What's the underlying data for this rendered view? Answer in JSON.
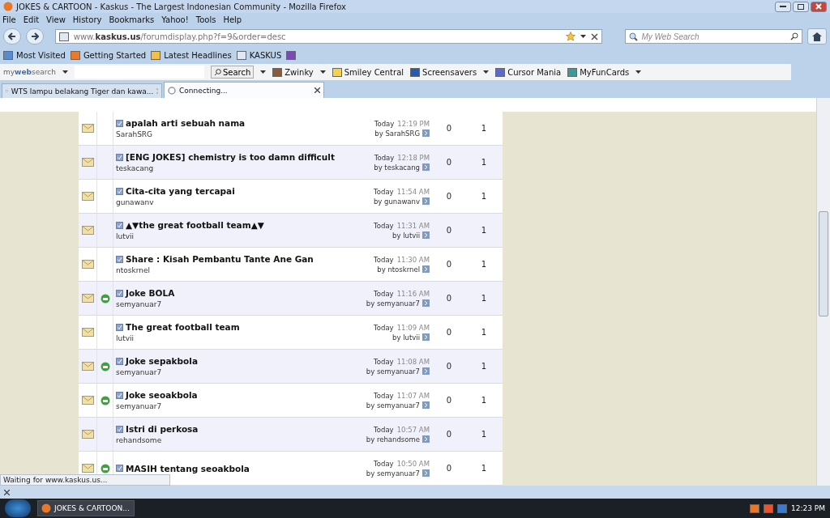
{
  "window": {
    "title": "JOKES & CARTOON - Kaskus - The Largest Indonesian Community - Mozilla Firefox"
  },
  "menu": [
    "File",
    "Edit",
    "View",
    "History",
    "Bookmarks",
    "Yahoo!",
    "Tools",
    "Help"
  ],
  "address": {
    "host": "www.",
    "domain": "kaskus.us",
    "path": "/forumdisplay.php?f=9&order=desc"
  },
  "search": {
    "placeholder": "My Web Search"
  },
  "bookmarks": [
    "Most Visited",
    "Getting Started",
    "Latest Headlines",
    "KASKUS"
  ],
  "toolbar": {
    "brand_prefix": "my",
    "brand_bold": "web",
    "brand_suffix": "search",
    "search_button": "Search",
    "items": [
      "Zwinky",
      "Smiley Central",
      "Screensavers",
      "Cursor Mania",
      "MyFunCards"
    ]
  },
  "tabs": [
    {
      "label": "WTS lampu belakang Tiger dan kawa...",
      "selected": false
    },
    {
      "label": "Connecting...",
      "selected": true
    }
  ],
  "threads": [
    {
      "title": "apalah arti sebuah nama",
      "author": "SarahSRG",
      "posticon": false,
      "date": "Today",
      "time": "12:19 PM",
      "by": "by SarahSRG",
      "replies": "0",
      "views": "1"
    },
    {
      "title": "[ENG JOKES] chemistry is too damn difficult",
      "author": "teskacang",
      "posticon": false,
      "date": "Today",
      "time": "12:18 PM",
      "by": "by teskacang",
      "replies": "0",
      "views": "1"
    },
    {
      "title": "Cita-cita yang tercapai",
      "author": "gunawanv",
      "posticon": false,
      "date": "Today",
      "time": "11:54 AM",
      "by": "by gunawanv",
      "replies": "0",
      "views": "1"
    },
    {
      "title": "▲▼the great football team▲▼",
      "author": "lutvii",
      "posticon": false,
      "date": "Today",
      "time": "11:31 AM",
      "by": "by lutvii",
      "replies": "0",
      "views": "1"
    },
    {
      "title": "Share : Kisah Pembantu Tante Ane Gan",
      "author": "ntoskrnel",
      "posticon": false,
      "date": "Today",
      "time": "11:30 AM",
      "by": "by ntoskrnel",
      "replies": "0",
      "views": "1"
    },
    {
      "title": "Joke BOLA",
      "author": "semyanuar7",
      "posticon": true,
      "date": "Today",
      "time": "11:16 AM",
      "by": "by semyanuar7",
      "replies": "0",
      "views": "1"
    },
    {
      "title": "The great football team",
      "author": "lutvii",
      "posticon": false,
      "date": "Today",
      "time": "11:09 AM",
      "by": "by lutvii",
      "replies": "0",
      "views": "1"
    },
    {
      "title": "Joke sepakbola",
      "author": "semyanuar7",
      "posticon": true,
      "date": "Today",
      "time": "11:08 AM",
      "by": "by semyanuar7",
      "replies": "0",
      "views": "1"
    },
    {
      "title": "Joke seoakbola",
      "author": "semyanuar7",
      "posticon": true,
      "date": "Today",
      "time": "11:07 AM",
      "by": "by semyanuar7",
      "replies": "0",
      "views": "1"
    },
    {
      "title": "Istri di perkosa",
      "author": "rehandsome",
      "posticon": false,
      "date": "Today",
      "time": "10:57 AM",
      "by": "by rehandsome",
      "replies": "0",
      "views": "1"
    },
    {
      "title": "MASIH tentang seoakbola",
      "posticon": true,
      "date": "Today",
      "time": "10:50 AM",
      "by": "by semyanuar7",
      "replies": "0",
      "views": "1"
    }
  ],
  "status_bar": {
    "text": "Waiting for www.kaskus.us..."
  },
  "taskbar": {
    "task": "JOKES & CARTOON...",
    "clock": "12:23 PM"
  }
}
